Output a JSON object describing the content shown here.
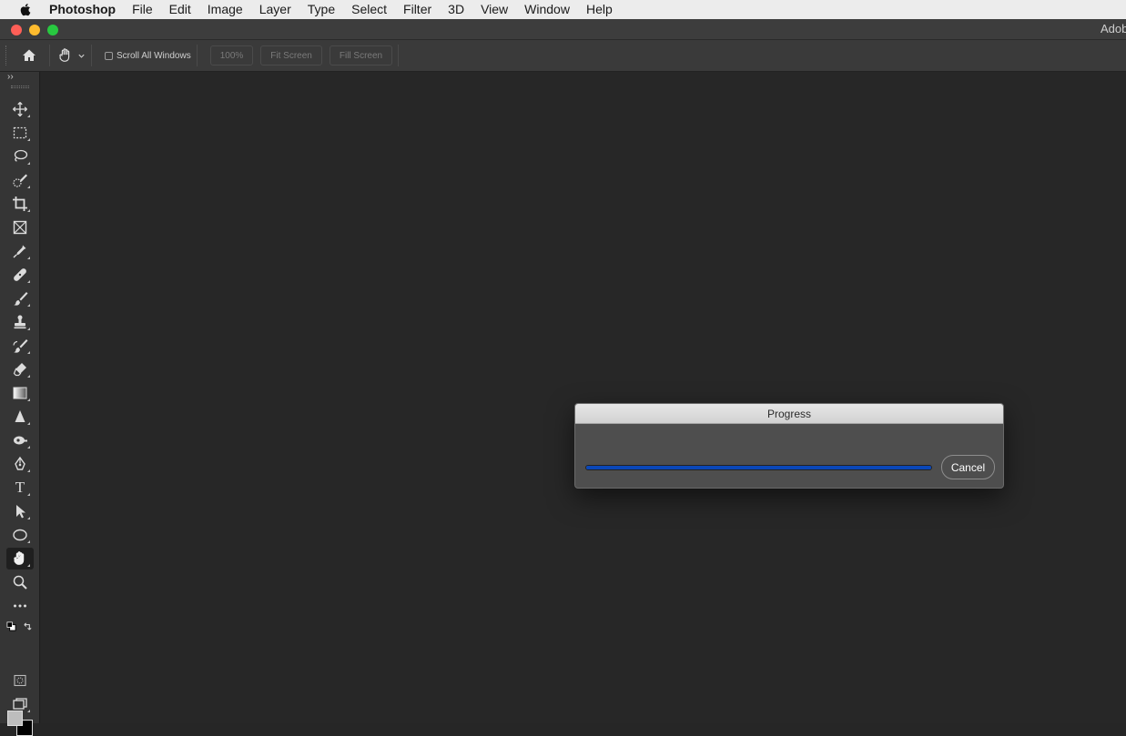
{
  "menubar": {
    "app_name": "Photoshop",
    "items": [
      "File",
      "Edit",
      "Image",
      "Layer",
      "Type",
      "Select",
      "Filter",
      "3D",
      "View",
      "Window",
      "Help"
    ]
  },
  "window": {
    "title": "Adob"
  },
  "options_bar": {
    "scroll_all_windows_label": "Scroll All Windows",
    "zoom_100_label": "100%",
    "fit_screen_label": "Fit Screen",
    "fill_screen_label": "Fill Screen"
  },
  "tools": {
    "collapse_label": "››",
    "type_tool_glyph": "T",
    "items": [
      "move-icon",
      "marquee-icon",
      "lasso-icon",
      "quick-selection-icon",
      "crop-icon",
      "frame-icon",
      "eyedropper-icon",
      "healing-brush-icon",
      "brush-icon",
      "clone-stamp-icon",
      "history-brush-icon",
      "eraser-icon",
      "gradient-icon",
      "blur-icon",
      "dodge-icon",
      "pen-icon",
      "type-icon",
      "path-selection-icon",
      "ellipse-icon",
      "hand-icon",
      "zoom-icon",
      "more-tools-icon",
      "quick-mask-icon",
      "screen-mode-icon"
    ],
    "active": "hand-icon",
    "foreground_color": "#bdbdbd",
    "background_color": "#000000"
  },
  "dialog": {
    "title": "Progress",
    "progress": 1.0,
    "progress_color": "#0a47b8",
    "cancel_label": "Cancel"
  }
}
